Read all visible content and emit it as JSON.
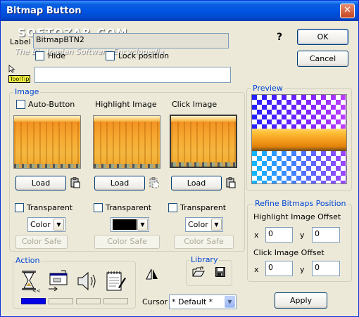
{
  "window": {
    "title": "Bitmap Button",
    "close_glyph": "✕"
  },
  "label_row": {
    "label": "Label",
    "value": "BitmapBTN2",
    "help_glyph": "?"
  },
  "hide": {
    "label": "Hide",
    "checked": false
  },
  "lock_position": {
    "label": "Lock position",
    "checked": false
  },
  "tooltip": {
    "tag": "ToolTip",
    "value": ""
  },
  "buttons": {
    "ok": "OK",
    "cancel": "Cancel",
    "apply": "Apply"
  },
  "image_group": {
    "title": "Image",
    "columns": [
      {
        "heading": "Auto-Button",
        "load": "Load",
        "transparent": "Transparent",
        "color_value": "Color",
        "color_safe": "Color Safe"
      },
      {
        "heading": "Highlight Image",
        "load": "Load",
        "transparent": "Transparent",
        "color_value": "",
        "color_safe": "Color Safe"
      },
      {
        "heading": "Click Image",
        "load": "Load",
        "transparent": "Transparent",
        "color_value": "Color",
        "color_safe": "Color Safe"
      }
    ]
  },
  "preview_group": {
    "title": "Preview"
  },
  "refine_group": {
    "title": "Refine Bitmaps Position",
    "highlight_label": "Highlight Image Offset",
    "click_label": "Click Image Offset",
    "x_label": "x",
    "y_label": "y",
    "highlight_x": "0",
    "highlight_y": "0",
    "click_x": "0",
    "click_y": "0"
  },
  "action_group": {
    "title": "Action"
  },
  "library_group": {
    "title": "Library"
  },
  "cursor": {
    "label": "Cursor",
    "value": "* Default *"
  },
  "watermark": {
    "line1": "SOFTOZAR.COM",
    "line2": "The Big Iranian Software Encyclopedia"
  },
  "colors": {
    "title_bar": "#0054e3",
    "group_title": "#0046d5",
    "face": "#ece9d8",
    "action_active": "#0000e6"
  }
}
